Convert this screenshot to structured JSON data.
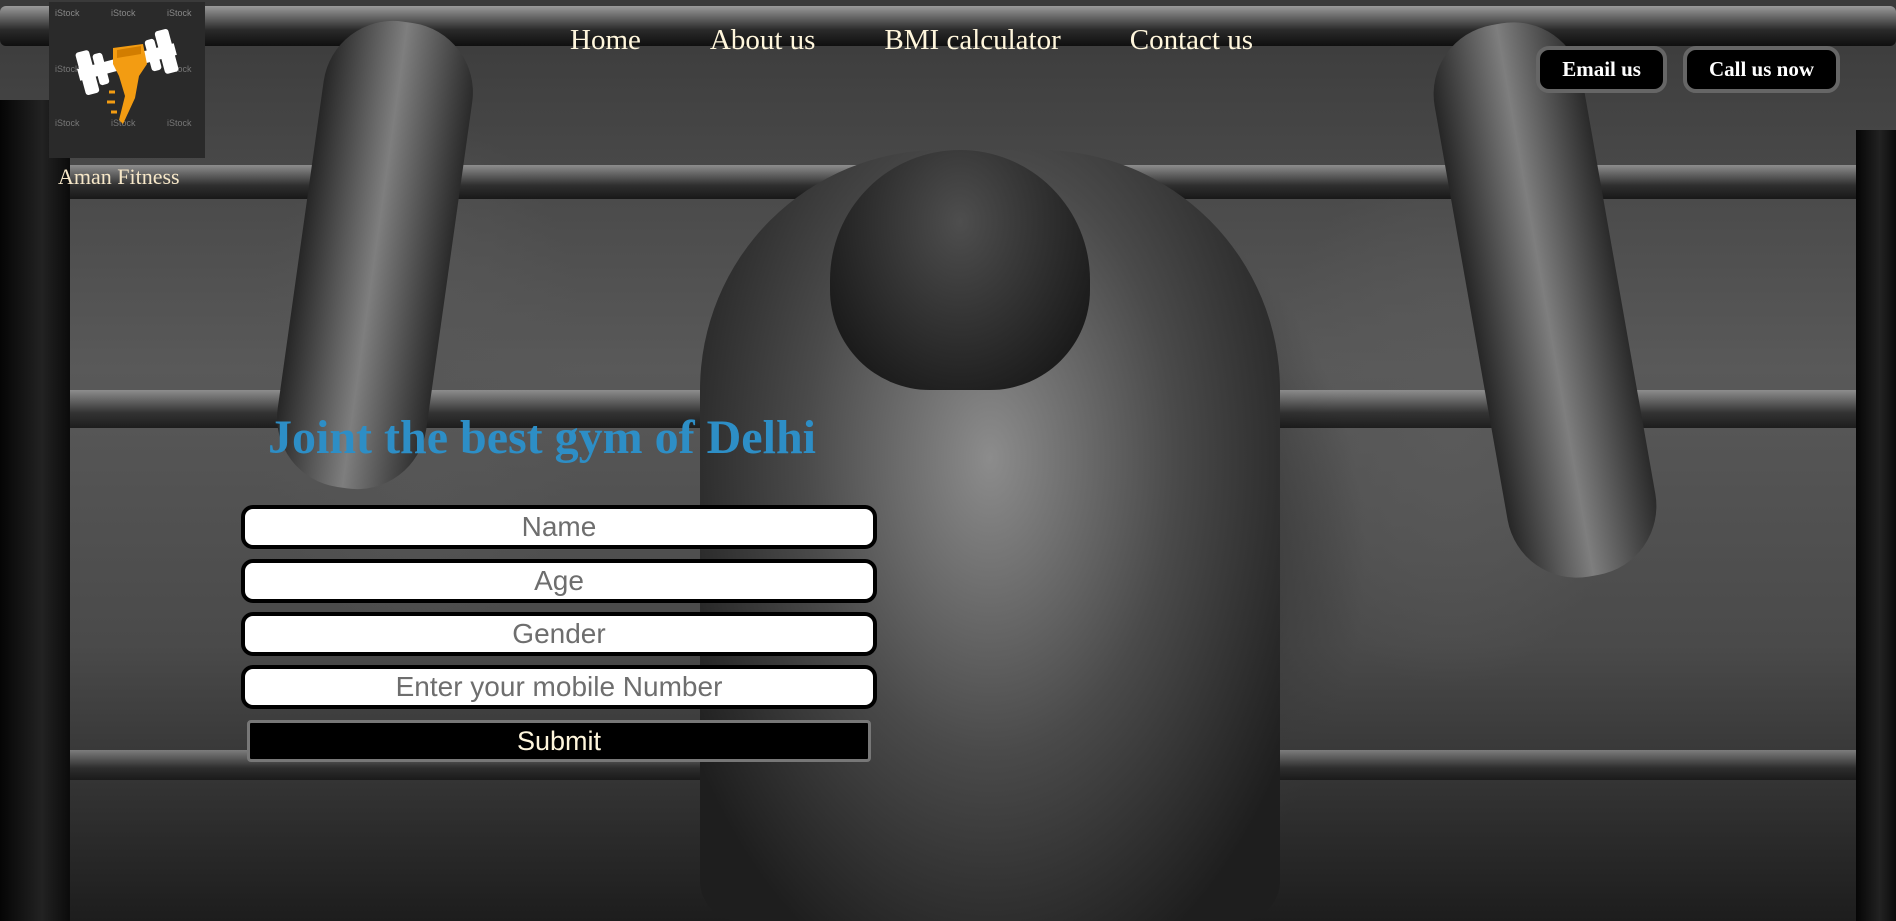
{
  "brand": {
    "name": "Aman Fitness",
    "logo_watermark": "iStock"
  },
  "nav": {
    "items": [
      {
        "label": "Home"
      },
      {
        "label": "About us"
      },
      {
        "label": "BMI calculator"
      },
      {
        "label": "Contact us"
      }
    ]
  },
  "actions": {
    "email_label": "Email us",
    "call_label": "Call us now"
  },
  "signup": {
    "headline": "Joint the best gym of Delhi",
    "fields": [
      {
        "placeholder": "Name",
        "value": ""
      },
      {
        "placeholder": "Age",
        "value": ""
      },
      {
        "placeholder": "Gender",
        "value": ""
      },
      {
        "placeholder": "Enter your mobile Number",
        "value": ""
      }
    ],
    "submit_label": "Submit"
  },
  "colors": {
    "accent": "#2d8ec6",
    "nav_text": "#fff6dc",
    "button_bg": "#000000",
    "logo_fist": "#f39c12"
  },
  "icons": {
    "logo": "dumbbell-fist-icon"
  }
}
